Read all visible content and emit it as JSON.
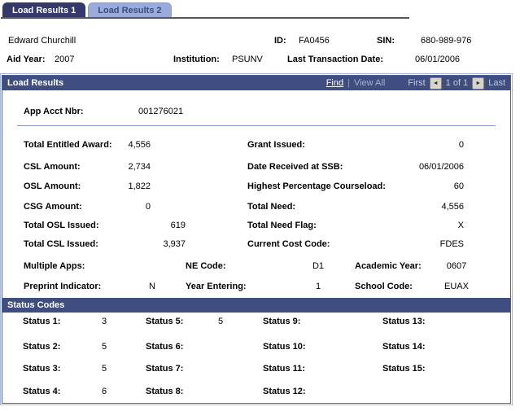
{
  "tabs": [
    {
      "label": "Load Results 1",
      "active": true
    },
    {
      "label": "Load Results 2",
      "active": false
    }
  ],
  "student": {
    "name": "Edward Churchill",
    "id_label": "ID:",
    "id": "FA0456",
    "sin_label": "SIN:",
    "sin": "680-989-976",
    "aid_year_label": "Aid Year:",
    "aid_year": "2007",
    "institution_label": "Institution:",
    "institution": "PSUNV",
    "last_transaction_label": "Last Transaction Date:",
    "last_transaction": "06/01/2006"
  },
  "load_results": {
    "title": "Load Results",
    "nav": {
      "find": "Find",
      "separator": "|",
      "view_all": "View All",
      "first": "First",
      "prev_icon": "◄",
      "position": "1 of 1",
      "next_icon": "►",
      "last": "Last"
    },
    "fields": {
      "app_acct_nbr": {
        "label": "App Acct Nbr:",
        "value": "001276021"
      },
      "total_entitled_award": {
        "label": "Total Entitled Award:",
        "value": "4,556"
      },
      "csl_amount": {
        "label": "CSL Amount:",
        "value": "2,734"
      },
      "osl_amount": {
        "label": "OSL Amount:",
        "value": "1,822"
      },
      "csg_amount": {
        "label": "CSG Amount:",
        "value": "0"
      },
      "total_osl_issued": {
        "label": "Total OSL Issued:",
        "value": "619"
      },
      "total_csl_issued": {
        "label": "Total CSL Issued:",
        "value": "3,937"
      },
      "grant_issued": {
        "label": "Grant Issued:",
        "value": "0"
      },
      "date_received_at_ssb": {
        "label": "Date Received at SSB:",
        "value": "06/01/2006"
      },
      "highest_percentage_courseload": {
        "label": "Highest Percentage Courseload:",
        "value": "60"
      },
      "total_need": {
        "label": "Total Need:",
        "value": "4,556"
      },
      "total_need_flag": {
        "label": "Total Need Flag:",
        "value": "X"
      },
      "current_cost_code": {
        "label": "Current Cost Code:",
        "value": "FDES"
      },
      "multiple_apps": {
        "label": "Multiple Apps:",
        "value": ""
      },
      "ne_code": {
        "label": "NE Code:",
        "value": "D1"
      },
      "academic_year": {
        "label": "Academic Year:",
        "value": "0607"
      },
      "preprint_indicator": {
        "label": "Preprint Indicator:",
        "value": "N"
      },
      "year_entering": {
        "label": "Year Entering:",
        "value": "1"
      },
      "school_code": {
        "label": "School Code:",
        "value": "EUAX"
      }
    }
  },
  "status_codes": {
    "title": "Status Codes",
    "items": [
      {
        "label": "Status 1:",
        "value": "3"
      },
      {
        "label": "Status 2:",
        "value": "5"
      },
      {
        "label": "Status 3:",
        "value": "5"
      },
      {
        "label": "Status 4:",
        "value": "6"
      },
      {
        "label": "Status 5:",
        "value": "5"
      },
      {
        "label": "Status 6:",
        "value": ""
      },
      {
        "label": "Status 7:",
        "value": ""
      },
      {
        "label": "Status 8:",
        "value": ""
      },
      {
        "label": "Status 9:",
        "value": ""
      },
      {
        "label": "Status 10:",
        "value": ""
      },
      {
        "label": "Status 11:",
        "value": ""
      },
      {
        "label": "Status 12:",
        "value": ""
      },
      {
        "label": "Status 13:",
        "value": ""
      },
      {
        "label": "Status 14:",
        "value": ""
      },
      {
        "label": "Status 15:",
        "value": ""
      }
    ]
  },
  "colors": {
    "section_header_bar": "#3f4e7e",
    "tab_active": "#35386b",
    "tab_inactive": "#98abdc",
    "groupbox_border": "#4f609a",
    "separator_line": "#8090c0"
  }
}
